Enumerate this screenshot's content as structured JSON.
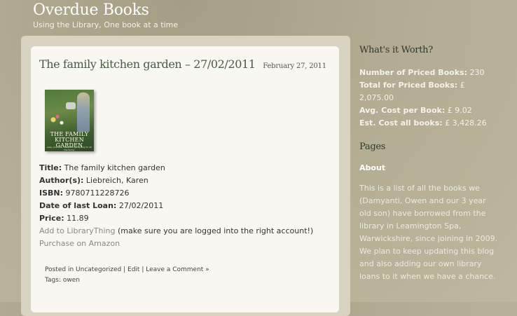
{
  "site": {
    "title": "Overdue Books",
    "tagline": "Using the Library, One book at a time"
  },
  "post": {
    "title": "The family kitchen garden – 27/02/2011",
    "date": "February 27, 2011",
    "cover": {
      "title_line1": "THE FAMILY",
      "title_line2": "KITCHEN GARDEN",
      "subtitle": "easy, practical, delightful gardening for all the family"
    },
    "fields": [
      {
        "label": "Title:",
        "value": "The family kitchen garden"
      },
      {
        "label": "Author(s):",
        "value": "Liebreich, Karen"
      },
      {
        "label": "ISBN:",
        "value": "9780711228726"
      },
      {
        "label": "Date of last Loan:",
        "value": "27/02/2011"
      },
      {
        "label": "Price:",
        "value": "11.89"
      }
    ],
    "librarything_link": "Add to LibraryThing",
    "librarything_note": "(make sure you are logged into the right account!)",
    "amazon_link": "Purchase on Amazon",
    "posted_in_prefix": "Posted in",
    "category": "Uncategorized",
    "edit_link": "Edit",
    "comment_link": "Leave a Comment »",
    "tags_prefix": "Tags:",
    "tag": "owen"
  },
  "sidebar": {
    "worth_heading": "What's it Worth?",
    "stats": [
      {
        "label": "Number of Priced Books:",
        "value": "230"
      },
      {
        "label": "Total for Priced Books:",
        "value": "£ 2,075.00"
      },
      {
        "label": "Avg. Cost per Book:",
        "value": "£ 9.02"
      },
      {
        "label": "Est. Cost all books:",
        "value": "£ 3,428.26"
      }
    ],
    "pages_heading": "Pages",
    "about_link": "About",
    "about_text": "This is a list of all the books we (Damyanti, Owen and our 3 year old son) have borrowed from the library in Leamington Spa, Warwickshire, since joining in 2009. We plan to keep updating this blog and also adding our own library loans to it when we have a chance."
  }
}
